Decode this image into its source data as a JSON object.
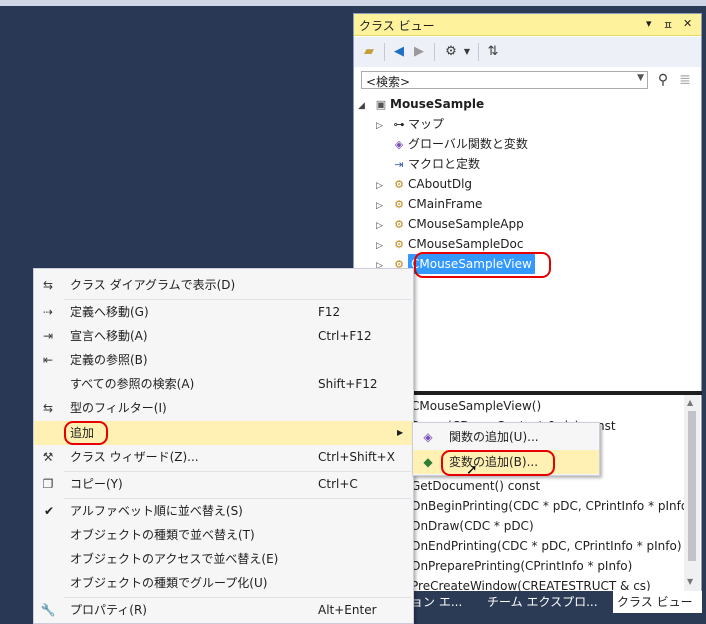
{
  "panel": {
    "title": "クラス ビュー",
    "controls": [
      "▾",
      "ㅍ",
      "✕"
    ],
    "search_placeholder": "<検索>",
    "tree": [
      {
        "label": "MouseSample",
        "bold": true,
        "expander": "◢",
        "icon": "project"
      },
      {
        "label": "マップ",
        "expander": "▷",
        "icon": "map"
      },
      {
        "label": "グローバル関数と変数",
        "expander": "",
        "icon": "globe"
      },
      {
        "label": "マクロと定数",
        "expander": "",
        "icon": "macro"
      },
      {
        "label": "CAboutDlg",
        "expander": "▷",
        "icon": "class"
      },
      {
        "label": "CMainFrame",
        "expander": "▷",
        "icon": "class"
      },
      {
        "label": "CMouseSampleApp",
        "expander": "▷",
        "icon": "class"
      },
      {
        "label": "CMouseSampleDoc",
        "expander": "▷",
        "icon": "class"
      },
      {
        "label": "CMouseSampleView",
        "expander": "▷",
        "icon": "class",
        "selected": true
      }
    ],
    "members": [
      "CMouseSampleView()",
      "Dump(CDumpContext & dc) const",
      "GetDocument() const",
      "OnBeginPrinting(CDC * pDC, CPrintInfo * pInfo)",
      "OnDraw(CDC * pDC)",
      "OnEndPrinting(CDC * pDC, CPrintInfo * pInfo)",
      "OnPreparePrinting(CPrintInfo * pInfo)",
      "PreCreateWindow(CREATESTRUCT & cs)"
    ],
    "tabs": [
      "ョン エ...",
      "チーム エクスプロ...",
      "クラス ビュー"
    ]
  },
  "menu": {
    "items": [
      {
        "label": "クラス ダイアグラムで表示(D)",
        "shortcut": "",
        "icon": "diagram-icon"
      },
      {
        "label": "定義へ移動(G)",
        "shortcut": "F12",
        "icon": "goto-definition-icon"
      },
      {
        "label": "宣言へ移動(A)",
        "shortcut": "Ctrl+F12",
        "icon": "goto-declaration-icon"
      },
      {
        "label": "定義の参照(B)",
        "shortcut": "",
        "icon": "browse-definition-icon"
      },
      {
        "label": "すべての参照の検索(A)",
        "shortcut": "Shift+F12",
        "icon": ""
      },
      {
        "label": "型のフィルター(I)",
        "shortcut": "",
        "icon": "filter-icon"
      },
      {
        "label": "追加",
        "shortcut": "",
        "icon": "",
        "submenu": true
      },
      {
        "label": "クラス ウィザード(Z)...",
        "shortcut": "Ctrl+Shift+X",
        "icon": "class-wizard-icon"
      },
      {
        "label": "コピー(Y)",
        "shortcut": "Ctrl+C",
        "icon": "copy-icon"
      },
      {
        "label": "アルファベット順に並べ替え(S)",
        "shortcut": "",
        "icon": "",
        "checked": true
      },
      {
        "label": "オブジェクトの種類で並べ替え(T)",
        "shortcut": "",
        "icon": ""
      },
      {
        "label": "オブジェクトのアクセスで並べ替え(E)",
        "shortcut": "",
        "icon": ""
      },
      {
        "label": "オブジェクトの種類でグループ化(U)",
        "shortcut": "",
        "icon": ""
      },
      {
        "label": "プロパティ(R)",
        "shortcut": "Alt+Enter",
        "icon": "wrench-icon"
      }
    ]
  },
  "submenu": {
    "items": [
      {
        "label": "関数の追加(U)...",
        "icon": "add-function-icon"
      },
      {
        "label": "変数の追加(B)...",
        "icon": "add-variable-icon"
      }
    ]
  },
  "colors": {
    "highlight": "#fff0b3",
    "selection": "#3399ff",
    "annotation": "#e60000",
    "title_bar": "#fff29d"
  }
}
